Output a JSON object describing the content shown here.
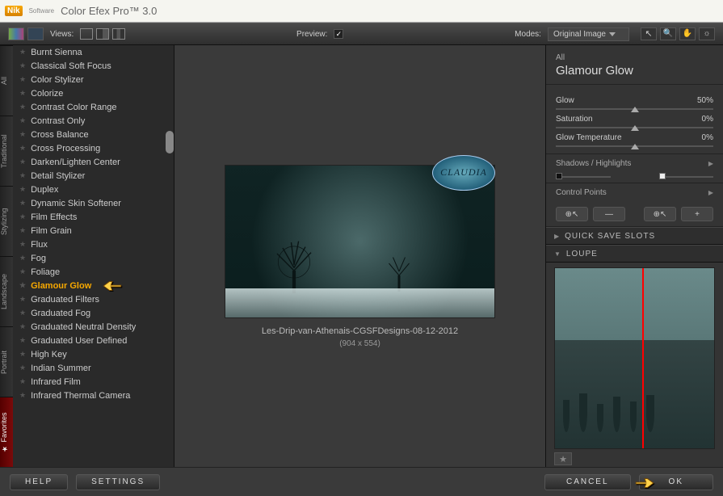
{
  "app": {
    "brand": "Nik",
    "sub": "Software",
    "title": "Color Efex Pro™ 3.0"
  },
  "toolbar": {
    "views_label": "Views:",
    "preview_label": "Preview:",
    "modes_label": "Modes:",
    "mode_value": "Original Image"
  },
  "categories": [
    {
      "label": "All"
    },
    {
      "label": "Traditional"
    },
    {
      "label": "Stylizing"
    },
    {
      "label": "Landscape"
    },
    {
      "label": "Portrait"
    },
    {
      "label": "Favorites"
    }
  ],
  "filters": [
    "Burnt Sienna",
    "Classical Soft Focus",
    "Color Stylizer",
    "Colorize",
    "Contrast Color Range",
    "Contrast Only",
    "Cross Balance",
    "Cross Processing",
    "Darken/Lighten Center",
    "Detail Stylizer",
    "Duplex",
    "Dynamic Skin Softener",
    "Film Effects",
    "Film Grain",
    "Flux",
    "Fog",
    "Foliage",
    "Glamour Glow",
    "Graduated Filters",
    "Graduated Fog",
    "Graduated Neutral Density",
    "Graduated User Defined",
    "High Key",
    "Indian Summer",
    "Infrared Film",
    "Infrared Thermal Camera"
  ],
  "selected_filter": "Glamour Glow",
  "preview": {
    "badge": "CLAUDIA",
    "name": "Les-Drip-van-Athenais-CGSFDesigns-08-12-2012",
    "dims": "(904 x 554)"
  },
  "panel": {
    "category": "All",
    "filter_name": "Glamour Glow",
    "sliders": [
      {
        "label": "Glow",
        "value": "50%",
        "pos": 50
      },
      {
        "label": "Saturation",
        "value": "0%",
        "pos": 50
      },
      {
        "label": "Glow Temperature",
        "value": "0%",
        "pos": 50
      }
    ],
    "shadows_label": "Shadows / Highlights",
    "control_points_label": "Control Points",
    "quick_save": "QUICK SAVE SLOTS",
    "loupe": "LOUPE"
  },
  "footer": {
    "help": "HELP",
    "settings": "SETTINGS",
    "cancel": "CANCEL",
    "ok": "OK"
  }
}
